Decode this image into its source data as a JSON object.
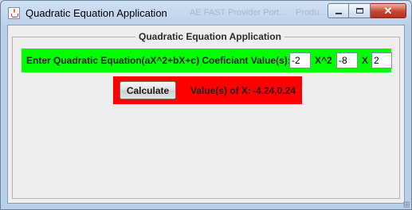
{
  "window": {
    "title": "Quadratic Equation Application",
    "background_titles": [
      "AE FAST Provider Port...",
      "Produ..."
    ]
  },
  "caption_buttons": {
    "minimize_icon": "minimize-icon",
    "maximize_icon": "maximize-icon",
    "close_icon": "close-icon",
    "close_glyph": "✕"
  },
  "group": {
    "title": "Quadratic Equation Application"
  },
  "equation": {
    "prompt": "Enter Quadratic Equation(aX^2+bX+c) Coeficiant Value(s):",
    "a_value": "-2",
    "x2_label": "X^2",
    "b_value": "-8",
    "x_label": "X",
    "c_value": "2"
  },
  "result": {
    "calculate_label": "Calculate",
    "label": "Value(s) of X:",
    "value": "-4.24,0.24"
  },
  "colors": {
    "equation_panel": "#00ff00",
    "result_panel": "#ff0000"
  }
}
